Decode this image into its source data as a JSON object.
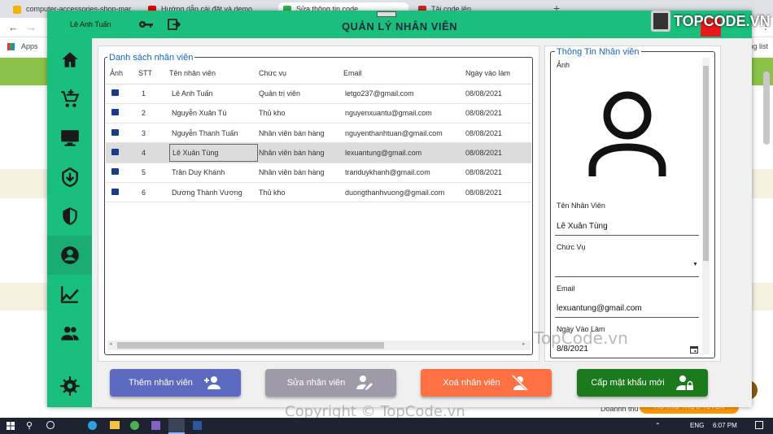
{
  "browser": {
    "tabs": [
      {
        "label": "computer-accessories-shop-mar",
        "color": "#f2b400"
      },
      {
        "label": "Hướng dẫn cài đặt và demo",
        "color": "#e00"
      },
      {
        "label": "Sửa thông tin code",
        "color": "#3ab04a"
      },
      {
        "label": "Tải code lên",
        "color": "#c62828"
      }
    ],
    "bookmarks_apps": "Apps",
    "reading_list": "Reading list",
    "avatar_text": "Tú"
  },
  "app": {
    "user_name": "Lê Anh Tuấn",
    "title": "QUẢN LÝ NHÂN VIÊN",
    "logo_text": "TOPCODE.VN",
    "nav_icons": [
      "home-icon",
      "cart-add-icon",
      "monitor-icon",
      "download-shield-icon",
      "shield-icon",
      "account-circle-icon",
      "chart-trend-icon",
      "people-icon",
      "settings-icon"
    ],
    "list": {
      "legend": "Danh sách nhân viên",
      "columns": [
        "Ảnh",
        "STT",
        "Tên nhân viên",
        "Chức vụ",
        "Email",
        "Ngày vào làm"
      ],
      "rows": [
        {
          "stt": "1",
          "name": "Lê Anh Tuấn",
          "role": "Quản trị viên",
          "email": "letgo237@gmail.com",
          "date": "08/08/2021"
        },
        {
          "stt": "2",
          "name": "Nguyễn Xuân Tú",
          "role": "Thủ kho",
          "email": "nguyenxuantu@gmail.com",
          "date": "08/08/2021"
        },
        {
          "stt": "3",
          "name": "Nguyễn Thanh Tuấn",
          "role": "Nhân viên bán hàng",
          "email": "nguyenthanhtuan@gmail.com",
          "date": "08/08/2021"
        },
        {
          "stt": "4",
          "name": "Lê Xuân Tùng",
          "role": "Nhân viên bán hàng",
          "email": "lexuantung@gmail.com",
          "date": "08/08/2021"
        },
        {
          "stt": "5",
          "name": "Trần Duy Khánh",
          "role": "Nhân viên bán hàng",
          "email": "tranduykhanh@gmail.com",
          "date": "08/08/2021"
        },
        {
          "stt": "6",
          "name": "Dương Thành Vương",
          "role": "Thủ kho",
          "email": "duongthanhvuong@gmail.com",
          "date": "08/08/2021"
        }
      ],
      "selected_index": 3
    },
    "detail": {
      "legend": "Thông Tin Nhân viên",
      "photo_label": "Ảnh",
      "name_label": "Tên Nhân Viên",
      "name_value": "Lê Xuân Tùng",
      "role_label": "Chức Vụ",
      "role_value": "",
      "email_label": "Email",
      "email_value": "lexuantung@gmail.com",
      "date_label": "Ngày Vào Làm",
      "date_value": "8/8/2021"
    },
    "buttons": {
      "add": {
        "label": "Thêm nhân viên",
        "color": "#5c6bc0"
      },
      "edit": {
        "label": "Sửa nhân viên",
        "color": "#9e9aa8"
      },
      "delete": {
        "label": "Xoá nhân viên",
        "color": "#ff7043"
      },
      "reset": {
        "label": "Cấp mật khẩu mới",
        "color": "#1b7a1b"
      }
    }
  },
  "background_page": {
    "doanh_thu": "Doanhh thu",
    "support": "HỖ TRỢ TRỰC TUYẾN"
  },
  "watermarks": {
    "center": "TopCode.vn",
    "bottom": "Copyright © TopCode.vn"
  },
  "taskbar": {
    "lang": "ENG",
    "time": "6:07 PM"
  }
}
